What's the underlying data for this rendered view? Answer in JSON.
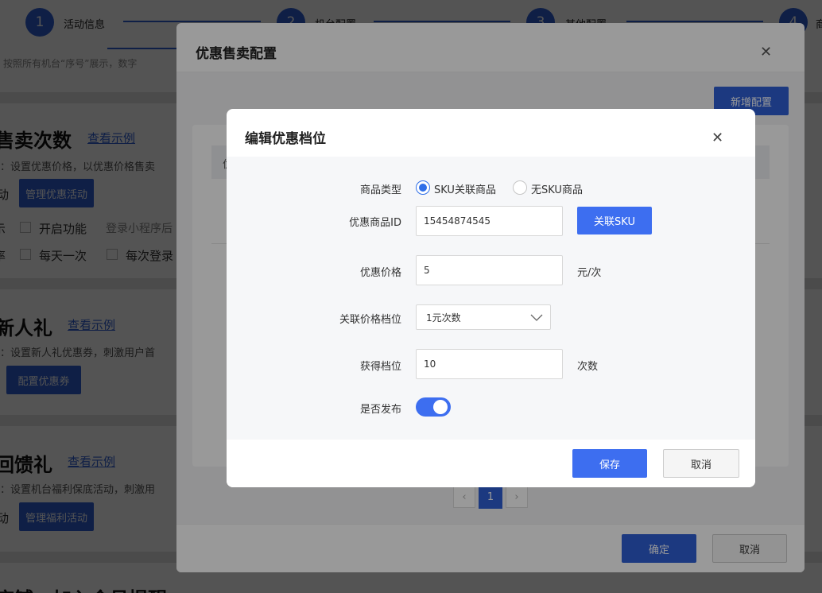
{
  "steps": [
    {
      "num": "1",
      "label": "活动信息"
    },
    {
      "num": "2",
      "label": "机台配置"
    },
    {
      "num": "3",
      "label": "其他配置"
    },
    {
      "num": "4",
      "label": "商"
    }
  ],
  "background": {
    "note": "按照所有机台“序号”展示，数字",
    "sections": [
      {
        "title": "售卖次数",
        "link": "查看示例",
        "desc": "：设置优惠价格，以优惠价格售卖",
        "button": "管理优惠活动",
        "lead": "动",
        "options_row1": {
          "lead": "示",
          "check": "开启功能",
          "hint": "登录小程序后"
        },
        "options_row2": {
          "lead": "率",
          "check1": "每天一次",
          "check2": "每次登录"
        }
      },
      {
        "title": "新人礼",
        "link": "查看示例",
        "desc": "：设置新人礼优惠券，刺激用户首",
        "button": "配置优惠券"
      },
      {
        "title": "回馈礼",
        "link": "查看示例",
        "desc": "：设置机台福利保底活动，刺激用",
        "button": "管理福利活动",
        "lead": "动"
      },
      {
        "title": "店铺、加入会员提醒"
      }
    ]
  },
  "discount_dialog": {
    "title": "优惠售卖配置",
    "add_button": "新增配置",
    "table_header_fragment": "优",
    "pagination": {
      "prev": "‹",
      "current": "1",
      "next": "›"
    },
    "ok_button": "确定",
    "cancel_button": "取消"
  },
  "edit_dialog": {
    "title": "编辑优惠档位",
    "product_type": {
      "label": "商品类型",
      "options": [
        "SKU关联商品",
        "无SKU商品"
      ],
      "selected": "SKU关联商品"
    },
    "product_id": {
      "label": "优惠商品ID",
      "value": "15454874545",
      "button": "关联SKU"
    },
    "price": {
      "label": "优惠价格",
      "value": "5",
      "unit": "元/次"
    },
    "price_tier": {
      "label": "关联价格档位",
      "value": "1元次数"
    },
    "gain": {
      "label": "获得档位",
      "value": "10",
      "unit": "次数"
    },
    "publish": {
      "label": "是否发布",
      "on": true
    },
    "save_button": "保存",
    "cancel_button": "取消"
  },
  "colors": {
    "primary": "#2f5fd6",
    "accent": "#3d6ef0",
    "overlay": "#000000"
  }
}
